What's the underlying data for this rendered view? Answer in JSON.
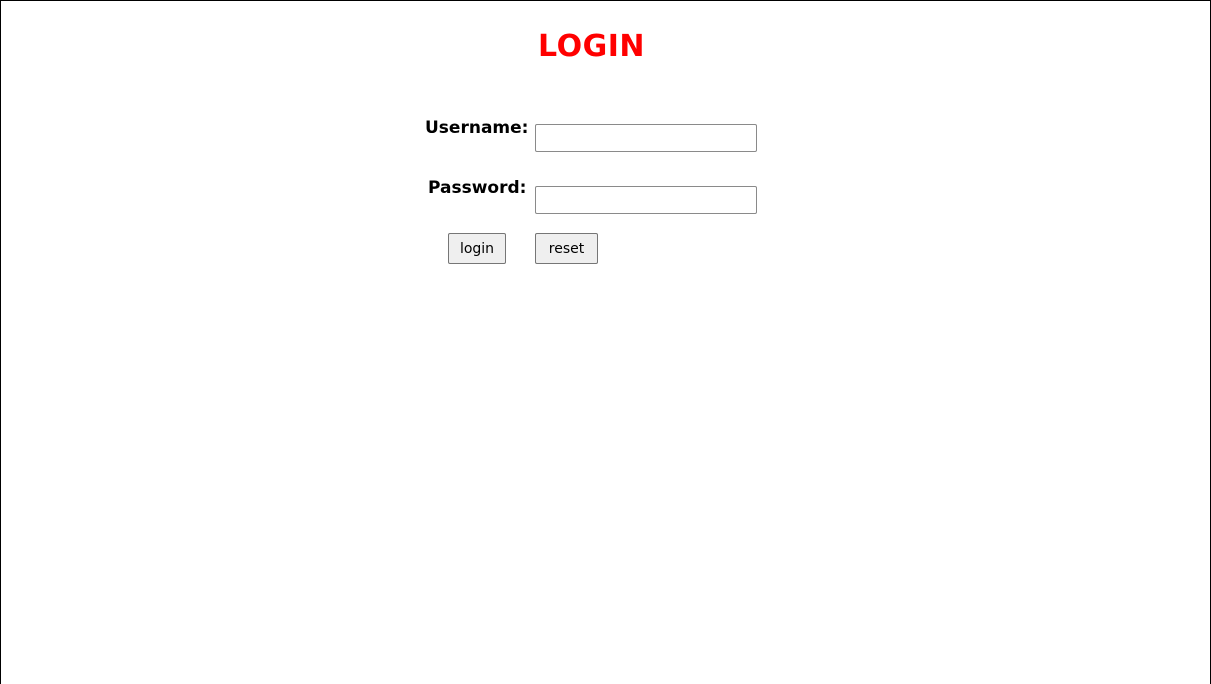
{
  "page": {
    "title": "LOGIN",
    "title_color": "#ff0000"
  },
  "form": {
    "username": {
      "label": "Username:",
      "value": "",
      "placeholder": ""
    },
    "password": {
      "label": "Password:",
      "value": "",
      "placeholder": ""
    },
    "login_label": "login",
    "reset_label": "reset"
  }
}
